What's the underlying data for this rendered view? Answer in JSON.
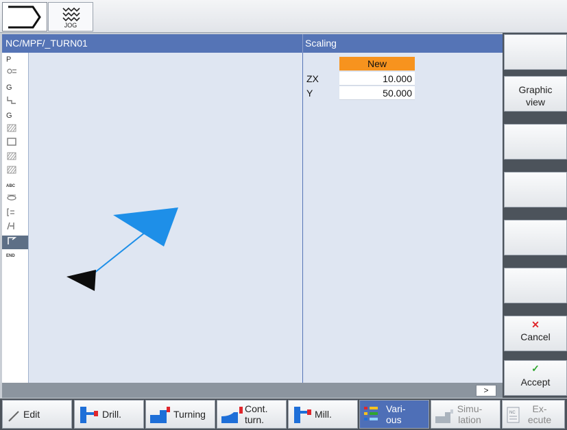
{
  "header": {
    "jog_label": "JOG"
  },
  "title": {
    "program_path": "NC/MPF/_TURN01",
    "form_title": "Scaling"
  },
  "sidebar": {
    "items": [
      {
        "label": "P"
      },
      {
        "label": "",
        "icon": "operation-icon"
      },
      {
        "label": "G"
      },
      {
        "label": "",
        "icon": "contour-icon"
      },
      {
        "label": "G"
      },
      {
        "label": "",
        "icon": "hatch-icon"
      },
      {
        "label": "",
        "icon": "frame-icon"
      },
      {
        "label": "",
        "icon": "hatch-icon"
      },
      {
        "label": "",
        "icon": "hatch-icon"
      },
      {
        "label": "ABC"
      },
      {
        "label": "",
        "icon": "cycle-icon"
      },
      {
        "label": "",
        "icon": "bracket-icon"
      },
      {
        "label": "",
        "icon": "measure-icon"
      },
      {
        "label": "",
        "icon": "scaling-icon"
      },
      {
        "label": "END"
      }
    ],
    "active_index": 13
  },
  "params": {
    "header": "New",
    "rows": [
      {
        "name": "ZX",
        "value": "10.000"
      },
      {
        "name": "Y",
        "value": "50.000"
      }
    ]
  },
  "status": {
    "more_label": ">"
  },
  "softkeys": {
    "graphic_view": "Graphic view",
    "cancel": "Cancel",
    "accept": "Accept"
  },
  "tabs": [
    {
      "label": "Edit"
    },
    {
      "label": "Drill."
    },
    {
      "label": "Turning"
    },
    {
      "label": "Cont. turn."
    },
    {
      "label": "Mill."
    },
    {
      "label": "Vari- ous"
    },
    {
      "label": "Simu- lation"
    },
    {
      "label": "Ex- ecute"
    }
  ],
  "colors": {
    "title_bar": "#5574b6",
    "header_orange": "#f7931e",
    "arrow_blue": "#1e8fe8",
    "cancel_red": "#e0262c",
    "accept_green": "#2fa62f"
  }
}
